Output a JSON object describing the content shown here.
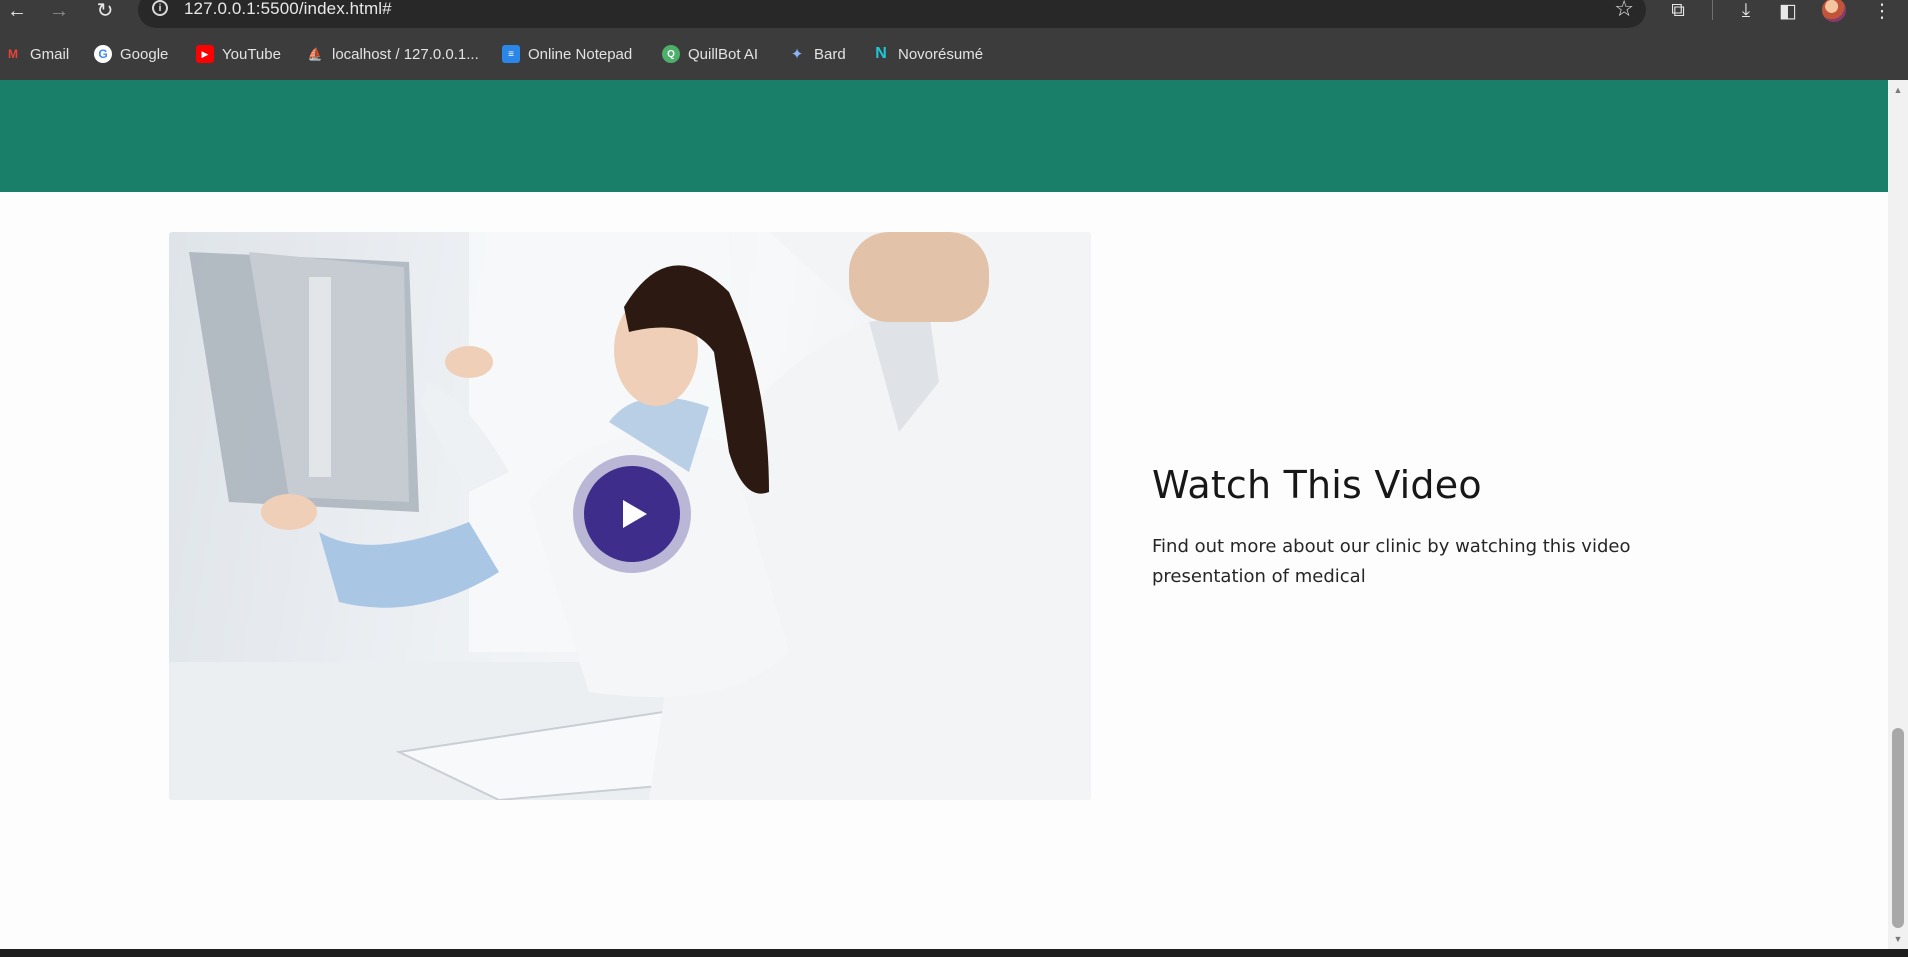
{
  "browser": {
    "url": "127.0.0.1:5500/index.html#",
    "bookmarks": [
      {
        "label": "Gmail",
        "icon": "gmail-icon"
      },
      {
        "label": "Google",
        "icon": "google-icon"
      },
      {
        "label": "YouTube",
        "icon": "youtube-icon"
      },
      {
        "label": "localhost / 127.0.0.1...",
        "icon": "phpmyadmin-icon"
      },
      {
        "label": "Online Notepad",
        "icon": "notepad-icon"
      },
      {
        "label": "QuillBot AI",
        "icon": "quillbot-icon"
      },
      {
        "label": "Bard",
        "icon": "bard-icon"
      },
      {
        "label": "Novorésumé",
        "icon": "novoresume-icon"
      }
    ]
  },
  "theme": {
    "header_band_color": "#1a7f68",
    "play_button_color": "#3f2d8c"
  },
  "video_section": {
    "title": "Watch This Video",
    "description": "Find out more about our clinic by watching this video presentation of medical",
    "image": "doctors-examining-xray-image"
  }
}
